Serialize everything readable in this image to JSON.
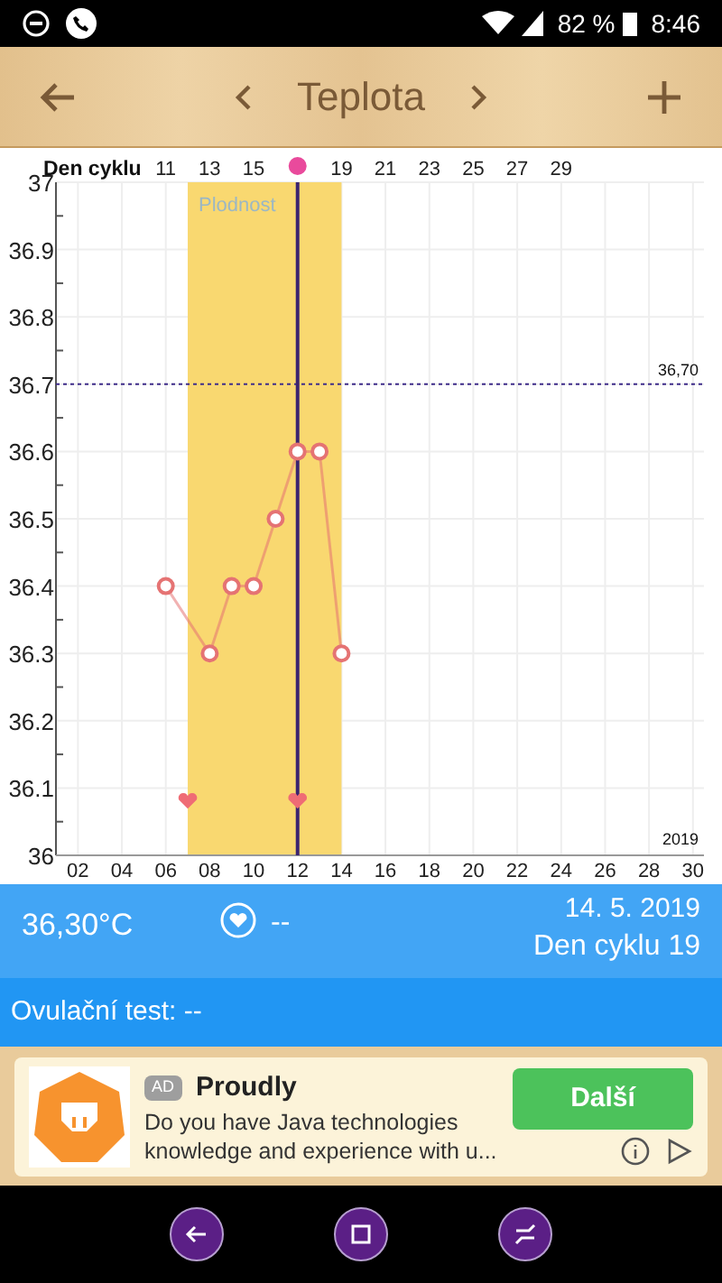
{
  "status_bar": {
    "battery": "82 %",
    "time": "8:46"
  },
  "app_bar": {
    "title": "Teplota"
  },
  "chart": {
    "top_axis": {
      "label": "Den cyklu",
      "ticks": [
        {
          "kind": "text",
          "label": "11"
        },
        {
          "kind": "text",
          "label": "13"
        },
        {
          "kind": "text",
          "label": "15"
        },
        {
          "kind": "dot"
        },
        {
          "kind": "text",
          "label": "19"
        },
        {
          "kind": "text",
          "label": "21"
        },
        {
          "kind": "text",
          "label": "23"
        },
        {
          "kind": "text",
          "label": "25"
        },
        {
          "kind": "text",
          "label": "27"
        },
        {
          "kind": "text",
          "label": "29"
        }
      ]
    },
    "year": "2019",
    "chart_data": {
      "type": "line",
      "grid": true,
      "x": [
        6,
        7,
        8,
        9,
        10,
        11,
        12,
        13,
        14
      ],
      "series": [
        {
          "color": "#e57373",
          "marker": "circle",
          "values": [
            36.4,
            null,
            36.3,
            36.4,
            36.4,
            36.5,
            36.6,
            36.6,
            36.3
          ]
        },
        {
          "type": "scatter",
          "color": "#ef6c75",
          "values": [
            null,
            36.08,
            null,
            null,
            null,
            null,
            36.08,
            null,
            null
          ]
        }
      ],
      "xlim": [
        1,
        30.5
      ],
      "ylim": [
        36,
        37
      ],
      "xticks": [
        {
          "value": 2,
          "label": "02"
        },
        {
          "value": 4,
          "label": "04"
        },
        {
          "value": 6,
          "label": "06"
        },
        {
          "value": 8,
          "label": "08"
        },
        {
          "value": 10,
          "label": "10"
        },
        {
          "value": 12,
          "label": "12"
        },
        {
          "value": 14,
          "label": "14"
        },
        {
          "value": 16,
          "label": "16"
        },
        {
          "value": 18,
          "label": "18"
        },
        {
          "value": 20,
          "label": "20"
        },
        {
          "value": 22,
          "label": "22"
        },
        {
          "value": 24,
          "label": "24"
        },
        {
          "value": 26,
          "label": "26"
        },
        {
          "value": 28,
          "label": "28"
        },
        {
          "value": 30,
          "label": "30"
        }
      ],
      "yticks": [
        {
          "value": 36,
          "label": "36"
        },
        {
          "value": 36.1,
          "label": "36.1"
        },
        {
          "value": 36.2,
          "label": "36.2"
        },
        {
          "value": 36.3,
          "label": "36.3"
        },
        {
          "value": 36.4,
          "label": "36.4"
        },
        {
          "value": 36.5,
          "label": "36.5"
        },
        {
          "value": 36.6,
          "label": "36.6"
        },
        {
          "value": 36.7,
          "label": "36.7"
        },
        {
          "value": 36.8,
          "label": "36.8"
        },
        {
          "value": 36.9,
          "label": "36.9"
        },
        {
          "value": 37,
          "label": "37"
        }
      ],
      "bands": [
        {
          "axis": "x",
          "from": 7,
          "to": 14,
          "label": "Plodnost"
        }
      ],
      "ref_lines": [
        {
          "axis": "y",
          "value": 36.7,
          "label": "36,70"
        },
        {
          "axis": "x",
          "value": 12
        }
      ]
    }
  },
  "info": {
    "temperature": "36,30°C",
    "intercourse": "--",
    "date": "14. 5. 2019",
    "cycle_day": "Den cyklu 19"
  },
  "ovulation": {
    "text": "Ovulační test: --"
  },
  "ad": {
    "badge": "AD",
    "title": "Proudly",
    "text": "Do you have Java technologies knowledge and experience with u...",
    "button": "Další"
  }
}
